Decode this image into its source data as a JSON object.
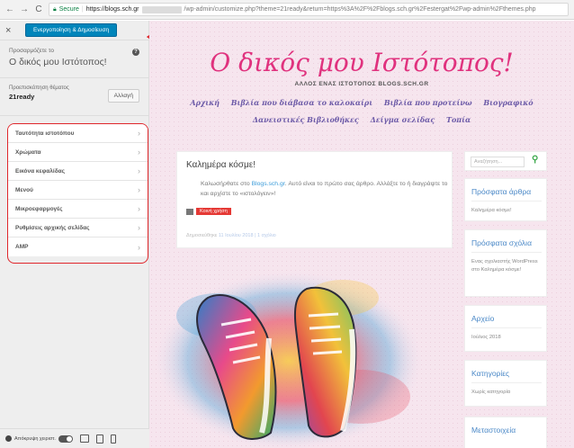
{
  "browser": {
    "back": "←",
    "forward": "→",
    "reload": "C",
    "secure_label": "Secure",
    "url_host": "https://blogs.sch.gr",
    "url_rest": "/wp-admin/customize.php?theme=21ready&return=https%3A%2F%2Fblogs.sch.gr%2Festergat%2Fwp-admin%2Fthemes.php"
  },
  "sidebar": {
    "close": "×",
    "publish_label": "Ενεργοποίηση & Δημοσίευση",
    "customizing_small": "Προσαρμόζετε το",
    "customizing_site": "Ο δικός μου Ιστότοπος!",
    "theme_preview_small": "Προεπισκόπηση θέματος",
    "theme_name": "21ready",
    "change_button": "Αλλαγή",
    "panels": [
      {
        "label": "Ταυτότητα ιστοτόπου"
      },
      {
        "label": "Χρώματα"
      },
      {
        "label": "Εικόνα κεφαλίδας"
      },
      {
        "label": "Μενού"
      },
      {
        "label": "Μικροεφαρμογές"
      },
      {
        "label": "Ρυθμίσεις αρχικής σελίδας"
      },
      {
        "label": "AMP"
      }
    ],
    "footer": {
      "hide_controls": "Απόκρυψη χειριστ."
    }
  },
  "preview": {
    "site_title": "Ο δικός μου Ιστότοπος!",
    "site_description": "ΑΛΛΟΣ ΕΝΑΣ ΙΣΤΟΤΟΠΟΣ BLOGS.SCH.GR",
    "menu_row1": [
      "Αρχική",
      "Βιβλία που διάβασα το καλοκαίρι",
      "Βιβλία που προτείνω",
      "Βιογραφικό"
    ],
    "menu_row2": [
      "Δανειστικές Βιβλιοθήκες",
      "Δείγμα σελίδας",
      "Τοπία"
    ],
    "post": {
      "title": "Καλημέρα κόσμε!",
      "body_before_link": "Καλωσήρθατε στο ",
      "body_link": "Blogs.sch.gr",
      "body_after_link": ". Αυτό είναι το πρώτο σας άρθρο. Αλλάξτε το ή διαγράψτε το και αρχίστε το «ιστολόγειν»!",
      "share_label": "Κοινή χρήση",
      "meta_prefix": "Δημοσιεύθηκε",
      "meta_date": "11 Ιουλίου 2018",
      "meta_sep": "|",
      "meta_comments": "1 σχόλιο"
    },
    "search": {
      "placeholder": "Αναζήτηση..."
    },
    "widgets": {
      "recent_posts_title": "Πρόσφατα άρθρα",
      "recent_posts_item": "Καλημέρα κόσμε!",
      "recent_comments_title": "Πρόσφατα σχόλια",
      "recent_comments_item": "Ενας σχολιαστής WordPress στο Καλημέρα κόσμε!",
      "archive_title": "Αρχείο",
      "archive_item": "Ιούλιος 2018",
      "categories_title": "Κατηγορίες",
      "categories_item": "Χωρίς κατηγορία",
      "meta_title": "Μεταστοιχεία"
    }
  },
  "colors": {
    "publish_blue": "#0085ba",
    "annotation_red": "#e0262b",
    "site_title_pink": "#e0327e",
    "menu_purple": "#6d5ba8",
    "widget_title_blue": "#4a88c7"
  }
}
